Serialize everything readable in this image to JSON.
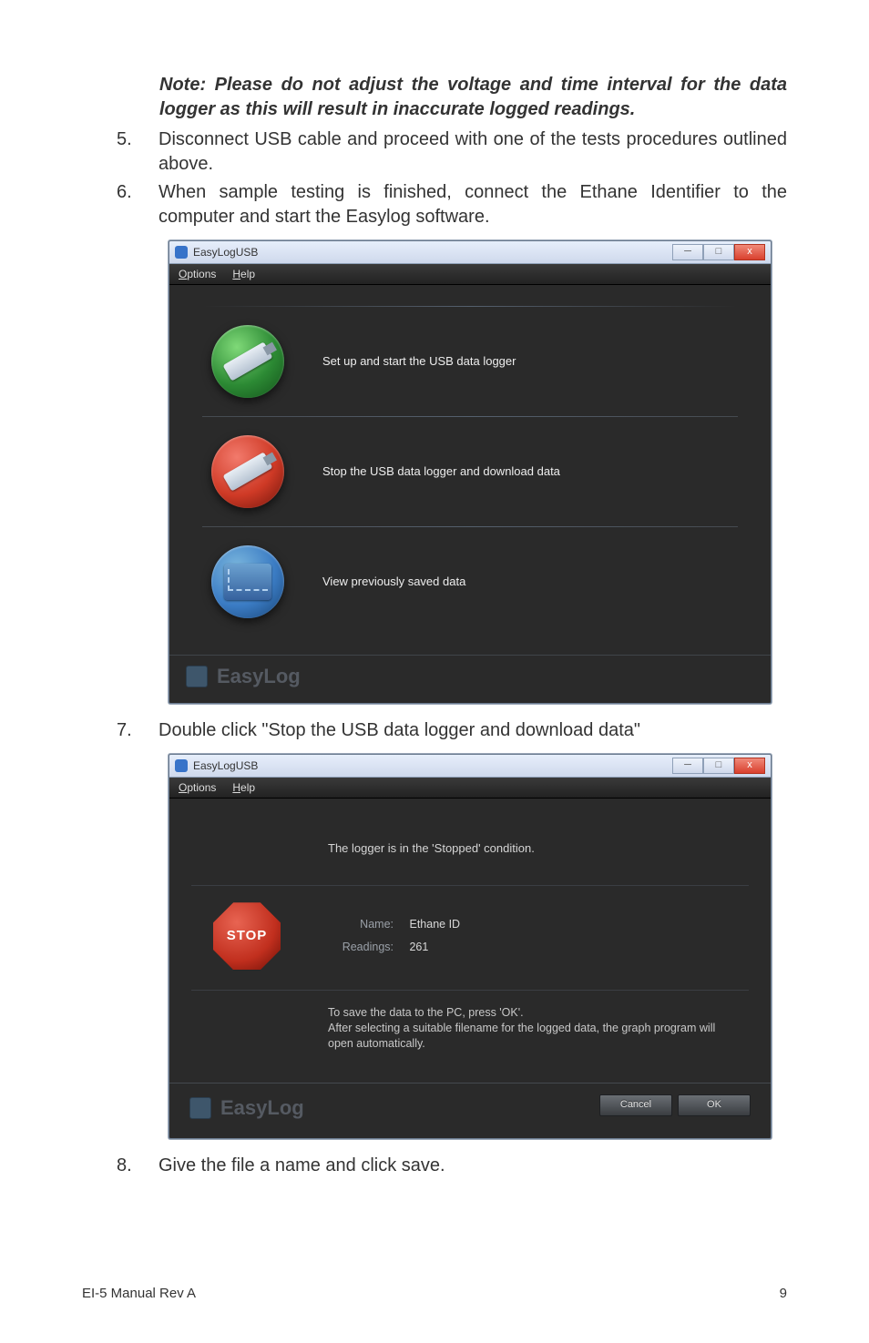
{
  "note": "Note: Please do not adjust the voltage and time interval for the data logger as this will result in inaccurate logged readings.",
  "step5_num": "5.",
  "step5": "Disconnect USB cable and proceed with one of the tests procedures outlined above.",
  "step6_num": "6.",
  "step6": "When sample testing is finished, connect the Ethane Identifier to the computer and start the Easylog software.",
  "screenshot1": {
    "title": "EasyLogUSB",
    "menu_options": "Options",
    "menu_help": "Help",
    "row1": "Set up and start the USB data logger",
    "row2": "Stop the USB data logger and download data",
    "row3": "View previously saved data",
    "footer": "EasyLog",
    "close": "x",
    "max": "□",
    "min": "─"
  },
  "step7_num": "7.",
  "step7": "Double click \"Stop the USB data logger and download data\"",
  "screenshot2": {
    "title": "EasyLogUSB",
    "menu_options": "Options",
    "menu_help": "Help",
    "status": "The logger is in the 'Stopped' condition.",
    "stop": "STOP",
    "name_label": "Name:",
    "name_value": "Ethane ID",
    "readings_label": "Readings:",
    "readings_value": "261",
    "instr1": "To save the data to the PC, press 'OK'.",
    "instr2": "After selecting a suitable filename for the logged data, the graph program will open automatically.",
    "footer": "EasyLog",
    "cancel": "Cancel",
    "ok": "OK",
    "close": "x",
    "max": "□",
    "min": "─"
  },
  "step8_num": "8.",
  "step8": "Give the file a name and click save.",
  "footer_left": "EI-5 Manual Rev A",
  "footer_right": "9"
}
